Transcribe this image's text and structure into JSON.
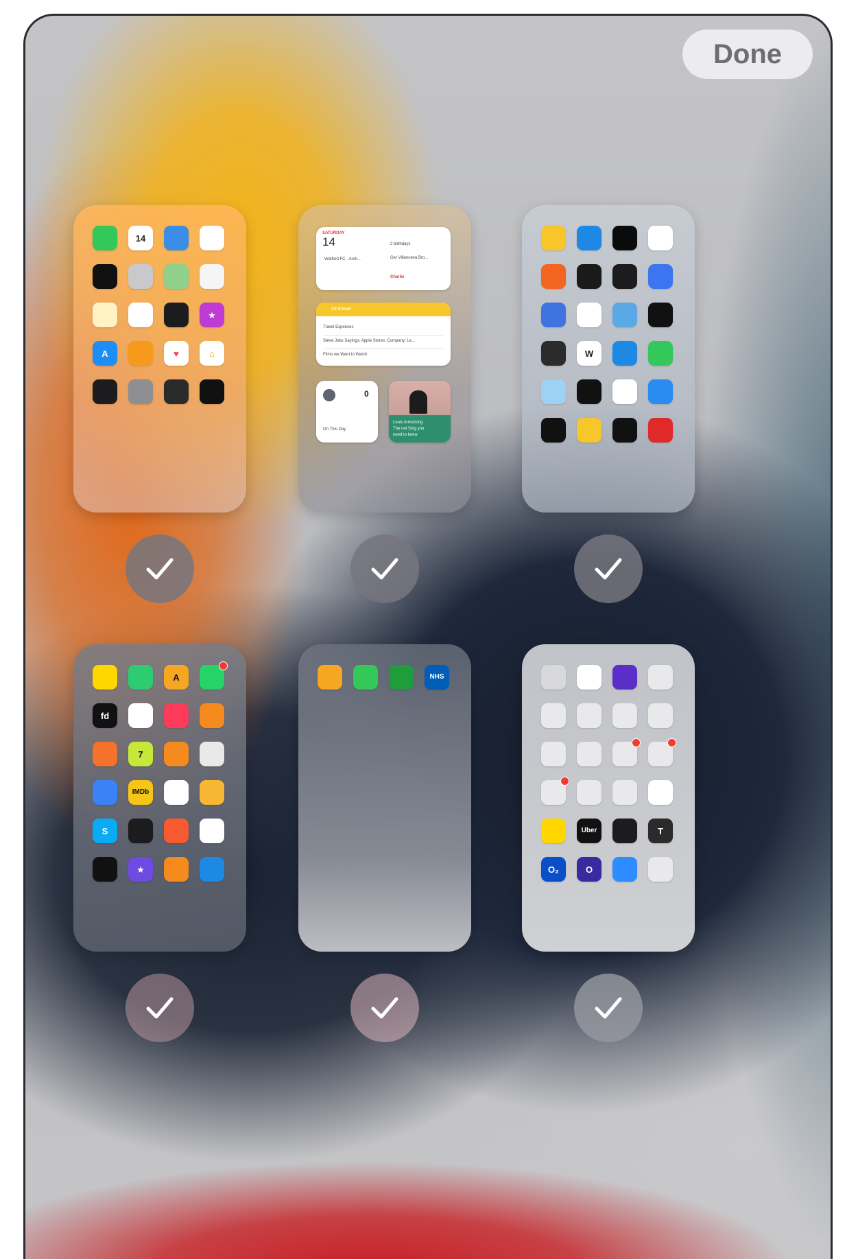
{
  "done_label": "Done",
  "pages": [
    {
      "apps": [
        {
          "icon": "messages-icon",
          "label": "",
          "bg": "#34c759"
        },
        {
          "icon": "calendar-icon",
          "label": "14",
          "bg": "#ffffff",
          "fg": "#222222"
        },
        {
          "icon": "weather-icon",
          "label": "",
          "bg": "#3a8ee6"
        },
        {
          "icon": "photos-icon",
          "label": "",
          "bg": "#ffffff"
        },
        {
          "icon": "clock-icon",
          "label": "",
          "bg": "#111111"
        },
        {
          "icon": "camera-icon",
          "label": "",
          "bg": "#c9c9cc"
        },
        {
          "icon": "maps-icon",
          "label": "",
          "bg": "#8fd18a"
        },
        {
          "icon": "news-icon",
          "label": "",
          "bg": "#f5f5f5"
        },
        {
          "icon": "notes-icon",
          "label": "",
          "bg": "#fff3c4"
        },
        {
          "icon": "reminders-icon",
          "label": "",
          "bg": "#ffffff"
        },
        {
          "icon": "stocks-icon",
          "label": "",
          "bg": "#1c1c1e"
        },
        {
          "icon": "itunes-store-icon",
          "label": "★",
          "bg": "#c03ad6"
        },
        {
          "icon": "app-store-icon",
          "label": "A",
          "bg": "#1e8ef5"
        },
        {
          "icon": "books-icon",
          "label": "",
          "bg": "#f79a1b"
        },
        {
          "icon": "health-icon",
          "label": "♥",
          "bg": "#ffffff",
          "fg": "#ff375f"
        },
        {
          "icon": "home-icon",
          "label": "⌂",
          "bg": "#ffffff",
          "fg": "#f39c12"
        },
        {
          "icon": "wallet-icon",
          "label": "",
          "bg": "#1c1c1e"
        },
        {
          "icon": "settings-icon",
          "label": "",
          "bg": "#8e8e93"
        },
        {
          "icon": "calculator-icon",
          "label": "",
          "bg": "#2b2b2b"
        },
        {
          "icon": "watch-icon",
          "label": "",
          "bg": "#111111"
        }
      ]
    },
    {
      "calendar_widget": {
        "day": "14",
        "header": "SATURDAY",
        "event": "Watford FC - Arsh...",
        "right_lines": [
          "2 birthdays",
          "Ger Villanueva Bro...",
          "Charlie"
        ]
      },
      "notes_widget": {
        "title": "All iCloud",
        "lines": [
          "Travel Expenses",
          "Steve Jobs Sayings: Apple Stores: Company: Le...",
          "Films we Want to Watch"
        ]
      },
      "small_widget": {
        "count": "0",
        "label": "On This Day"
      },
      "news_widget": {
        "lines": [
          "Louis Armstrong",
          "The net Sing you",
          "need to know"
        ]
      }
    },
    {
      "apps": [
        {
          "icon": "phone-app-icon",
          "label": "",
          "bg": "#f7c62b"
        },
        {
          "icon": "shortcuts-icon",
          "label": "",
          "bg": "#1e88e5"
        },
        {
          "icon": "fitness-drop-icon",
          "label": "",
          "bg": "#0b0b0b"
        },
        {
          "icon": "clock-app-icon",
          "label": "",
          "bg": "#ffffff"
        },
        {
          "icon": "orange-app-icon",
          "label": "",
          "bg": "#f2641f"
        },
        {
          "icon": "green-circle-icon",
          "label": "",
          "bg": "#1a1a1a"
        },
        {
          "icon": "speedometer-icon",
          "label": "",
          "bg": "#1c1c1e"
        },
        {
          "icon": "chat-icon",
          "label": "",
          "bg": "#3b76f0"
        },
        {
          "icon": "camera-outline-icon",
          "label": "",
          "bg": "#3f73e0"
        },
        {
          "icon": "freeform-icon",
          "label": "",
          "bg": "#ffffff"
        },
        {
          "icon": "cloud-scene-icon",
          "label": "",
          "bg": "#5aa9e6"
        },
        {
          "icon": "star-dark-icon",
          "label": "",
          "bg": "#111111"
        },
        {
          "icon": "ebook-icon",
          "label": "",
          "bg": "#2b2b2b"
        },
        {
          "icon": "wikipedia-icon",
          "label": "W",
          "bg": "#ffffff",
          "fg": "#222222"
        },
        {
          "icon": "files-icon",
          "label": "",
          "bg": "#1e88e5"
        },
        {
          "icon": "find-my-icon",
          "label": "",
          "bg": "#34c759"
        },
        {
          "icon": "cloud-icon",
          "label": "",
          "bg": "#9ed2f5"
        },
        {
          "icon": "camera-dark-icon",
          "label": "",
          "bg": "#111111"
        },
        {
          "icon": "grid-app-icon",
          "label": "",
          "bg": "#ffffff"
        },
        {
          "icon": "device-blue-icon",
          "label": "",
          "bg": "#2a8cf0"
        },
        {
          "icon": "voice-memos-icon",
          "label": "",
          "bg": "#111111"
        },
        {
          "icon": "tips-icon",
          "label": "",
          "bg": "#f7c62b"
        },
        {
          "icon": "activity-icon",
          "label": "",
          "bg": "#111111"
        },
        {
          "icon": "red-news-icon",
          "label": "",
          "bg": "#e02a2a"
        }
      ]
    },
    {
      "apps": [
        {
          "icon": "bitmoji-icon",
          "label": "",
          "bg": "#ffd600"
        },
        {
          "icon": "green-app-icon",
          "label": "",
          "bg": "#2ecc71"
        },
        {
          "icon": "arrow-a-icon",
          "label": "A",
          "bg": "#f5a623",
          "fg": "#111111"
        },
        {
          "icon": "whatsapp-icon",
          "label": "",
          "bg": "#25d366",
          "badge": true
        },
        {
          "icon": "fd-icon",
          "label": "fd",
          "bg": "#111111"
        },
        {
          "icon": "home-red-icon",
          "label": "",
          "bg": "#ffffff"
        },
        {
          "icon": "red-ring-icon",
          "label": "",
          "bg": "#ff3b5c"
        },
        {
          "icon": "orange-ball-icon",
          "label": "",
          "bg": "#f58a1f"
        },
        {
          "icon": "shield-orange-icon",
          "label": "",
          "bg": "#f5722b"
        },
        {
          "icon": "z-app-icon",
          "label": "7",
          "bg": "#c6e83a",
          "fg": "#111111"
        },
        {
          "icon": "orange-badge-icon",
          "label": "",
          "bg": "#f58a1f"
        },
        {
          "icon": "toggle-app-icon",
          "label": "",
          "bg": "#e9e9ea"
        },
        {
          "icon": "blue-app-icon",
          "label": "",
          "bg": "#3b82f6"
        },
        {
          "icon": "imdb-icon",
          "label": "IMDb",
          "bg": "#f5c518",
          "fg": "#111111"
        },
        {
          "icon": "xbox-icon",
          "label": "",
          "bg": "#ffffff"
        },
        {
          "icon": "pattern-app-icon",
          "label": "",
          "bg": "#f7b733"
        },
        {
          "icon": "skype-icon",
          "label": "S",
          "bg": "#0aaaf5"
        },
        {
          "icon": "games-icon",
          "label": "",
          "bg": "#1c1c1e"
        },
        {
          "icon": "guitar-icon",
          "label": "",
          "bg": "#f75a2f"
        },
        {
          "icon": "music-note-icon",
          "label": "",
          "bg": "#ffffff"
        },
        {
          "icon": "tv-app-icon",
          "label": "",
          "bg": "#111111"
        },
        {
          "icon": "imovie-star-icon",
          "label": "★",
          "bg": "#6d4ae0"
        },
        {
          "icon": "graduation-icon",
          "label": "",
          "bg": "#f58a1f"
        },
        {
          "icon": "keynote-icon",
          "label": "",
          "bg": "#1e88e5"
        }
      ]
    },
    {
      "apps": [
        {
          "icon": "pages-icon",
          "label": "",
          "bg": "#f5a623"
        },
        {
          "icon": "numbers-icon",
          "label": "",
          "bg": "#34c759"
        },
        {
          "icon": "calc-green-icon",
          "label": "",
          "bg": "#1f9d3a"
        },
        {
          "icon": "nhs-icon",
          "label": "NHS",
          "bg": "#005eb8"
        }
      ]
    },
    {
      "apps": [
        {
          "icon": "contacts-icon",
          "label": "",
          "bg": "#d8d8da"
        },
        {
          "icon": "google-maps-icon",
          "label": "",
          "bg": "#ffffff"
        },
        {
          "icon": "purple-app-icon",
          "label": "",
          "bg": "#5b2dc9"
        },
        {
          "icon": "folder-icon",
          "label": "",
          "bg": "#e9e9ec"
        },
        {
          "icon": "folder-icon",
          "label": "",
          "bg": "#e9e9ec"
        },
        {
          "icon": "folder-icon",
          "label": "",
          "bg": "#e9e9ec"
        },
        {
          "icon": "folder-icon",
          "label": "",
          "bg": "#e9e9ec"
        },
        {
          "icon": "folder-icon",
          "label": "",
          "bg": "#e9e9ec"
        },
        {
          "icon": "folder-icon",
          "label": "",
          "bg": "#e9e9ec"
        },
        {
          "icon": "folder-icon",
          "label": "",
          "bg": "#e9e9ec"
        },
        {
          "icon": "folder-icon",
          "label": "",
          "bg": "#e9e9ec",
          "badge": true
        },
        {
          "icon": "folder-icon",
          "label": "",
          "bg": "#e9e9ec",
          "badge": true
        },
        {
          "icon": "folder-icon",
          "label": "",
          "bg": "#e9e9ec",
          "badge": true
        },
        {
          "icon": "folder-icon",
          "label": "",
          "bg": "#e9e9ec"
        },
        {
          "icon": "folder-icon",
          "label": "",
          "bg": "#e9e9ec"
        },
        {
          "icon": "google-photos-icon",
          "label": "",
          "bg": "#ffffff"
        },
        {
          "icon": "sport-icon",
          "label": "",
          "bg": "#ffd600"
        },
        {
          "icon": "uber-icon",
          "label": "Uber",
          "bg": "#111111"
        },
        {
          "icon": "dark-circle-icon",
          "label": "",
          "bg": "#1c1c1e"
        },
        {
          "icon": "t-app-icon",
          "label": "T",
          "bg": "#2b2b2b"
        },
        {
          "icon": "o2-icon",
          "label": "O₂",
          "bg": "#0a4fc7"
        },
        {
          "icon": "o2-purple-icon",
          "label": "O",
          "bg": "#3a2aa0"
        },
        {
          "icon": "zoom-icon",
          "label": "",
          "bg": "#2d8cff"
        },
        {
          "icon": "folder-icon",
          "label": "",
          "bg": "#e9e9ec"
        }
      ]
    }
  ],
  "accent_colors": {
    "done_text": "#6d6d72",
    "check_bg": "#76767e"
  }
}
